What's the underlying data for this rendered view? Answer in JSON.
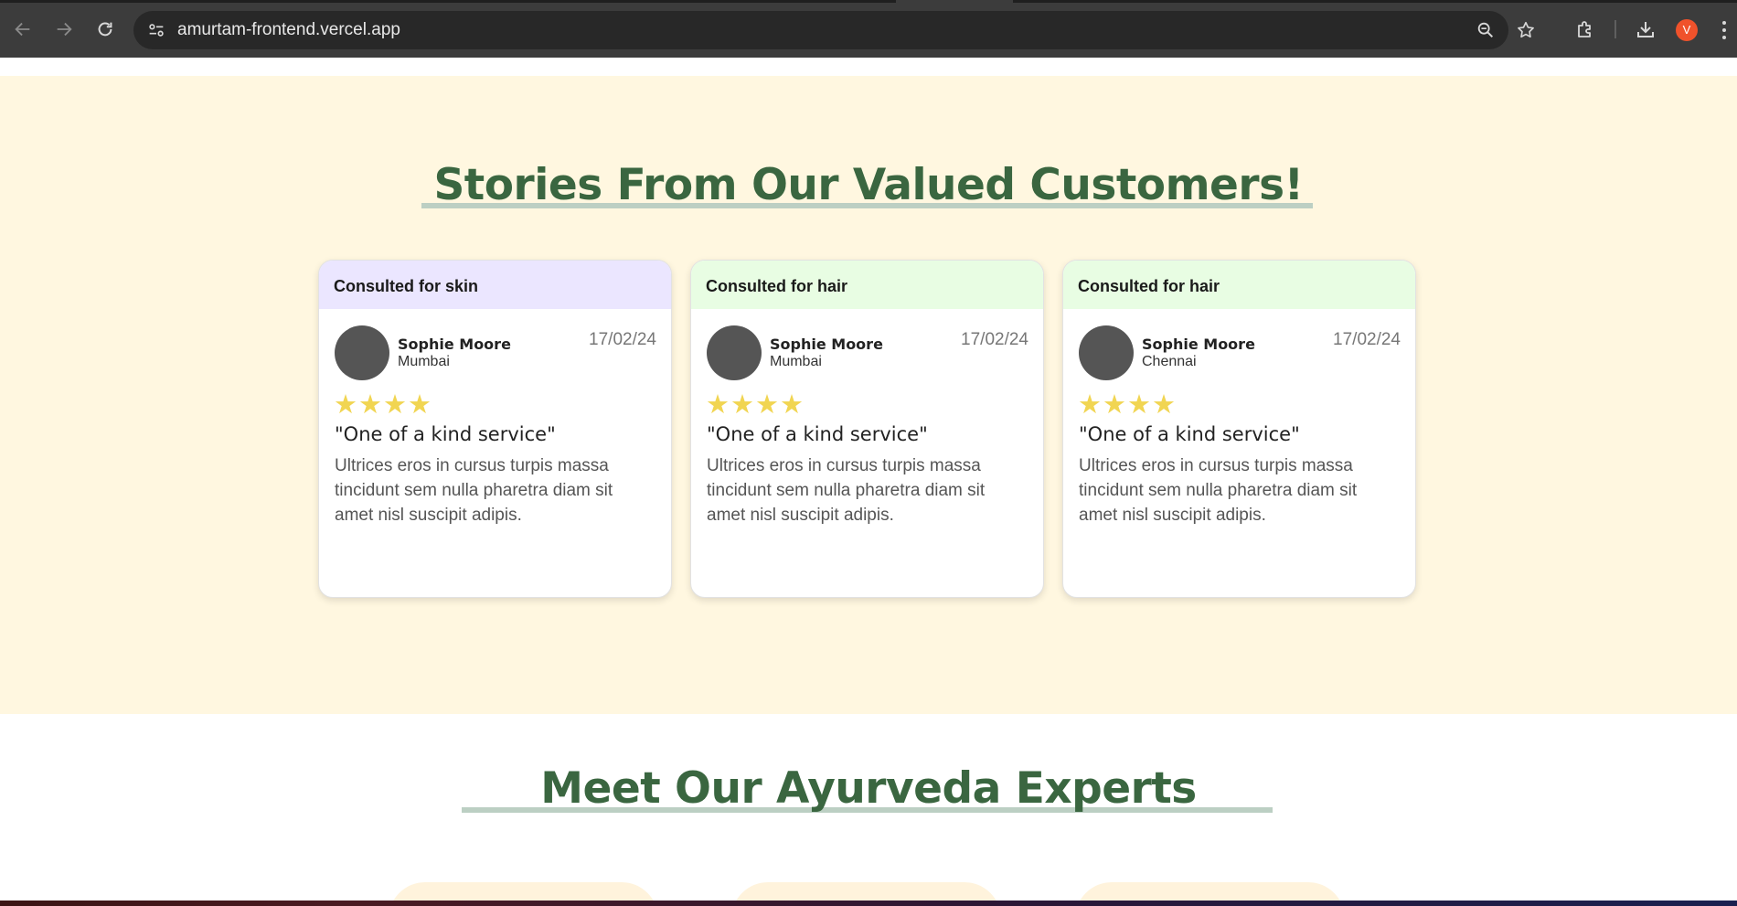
{
  "browser": {
    "url": "amurtam-frontend.vercel.app",
    "profile_initial": "V",
    "icons": {
      "back": "arrow-left-icon",
      "forward": "arrow-right-icon",
      "reload": "reload-icon",
      "site_info": "tune-icon",
      "zoom": "zoom-icon",
      "bookmark": "star-icon",
      "extensions": "puzzle-icon",
      "downloads": "download-icon",
      "menu": "more-vertical-icon"
    }
  },
  "stories": {
    "heading": "Stories From Our Valued Customers!",
    "cards": [
      {
        "category": "Consulted for skin",
        "header_color": "#ebe6ff",
        "name": "Sophie Moore",
        "city": "Mumbai",
        "date": "17/02/24",
        "stars": "★★★★",
        "rating": 4,
        "title": "\"One of a kind service\"",
        "body": "Ultrices eros in cursus turpis massa tincidunt sem nulla pharetra diam sit amet nisl suscipit adipis."
      },
      {
        "category": "Consulted for hair",
        "header_color": "#e8fde3",
        "name": "Sophie Moore",
        "city": "Mumbai",
        "date": "17/02/24",
        "stars": "★★★★",
        "rating": 4,
        "title": "\"One of a kind service\"",
        "body": "Ultrices eros in cursus turpis massa tincidunt sem nulla pharetra diam sit amet nisl suscipit adipis."
      },
      {
        "category": "Consulted for hair",
        "header_color": "#e8fde3",
        "name": "Sophie Moore",
        "city": "Chennai",
        "date": "17/02/24",
        "stars": "★★★★",
        "rating": 4,
        "title": "\"One of a kind service\"",
        "body": "Ultrices eros in cursus turpis massa tincidunt sem nulla pharetra diam sit amet nisl suscipit adipis."
      }
    ]
  },
  "experts": {
    "heading": "Meet Our Ayurveda Experts"
  },
  "colors": {
    "section_bg": "#fff7e0",
    "heading_green": "#3a6640",
    "underline": "#bccfc3",
    "star": "#f1d552"
  }
}
